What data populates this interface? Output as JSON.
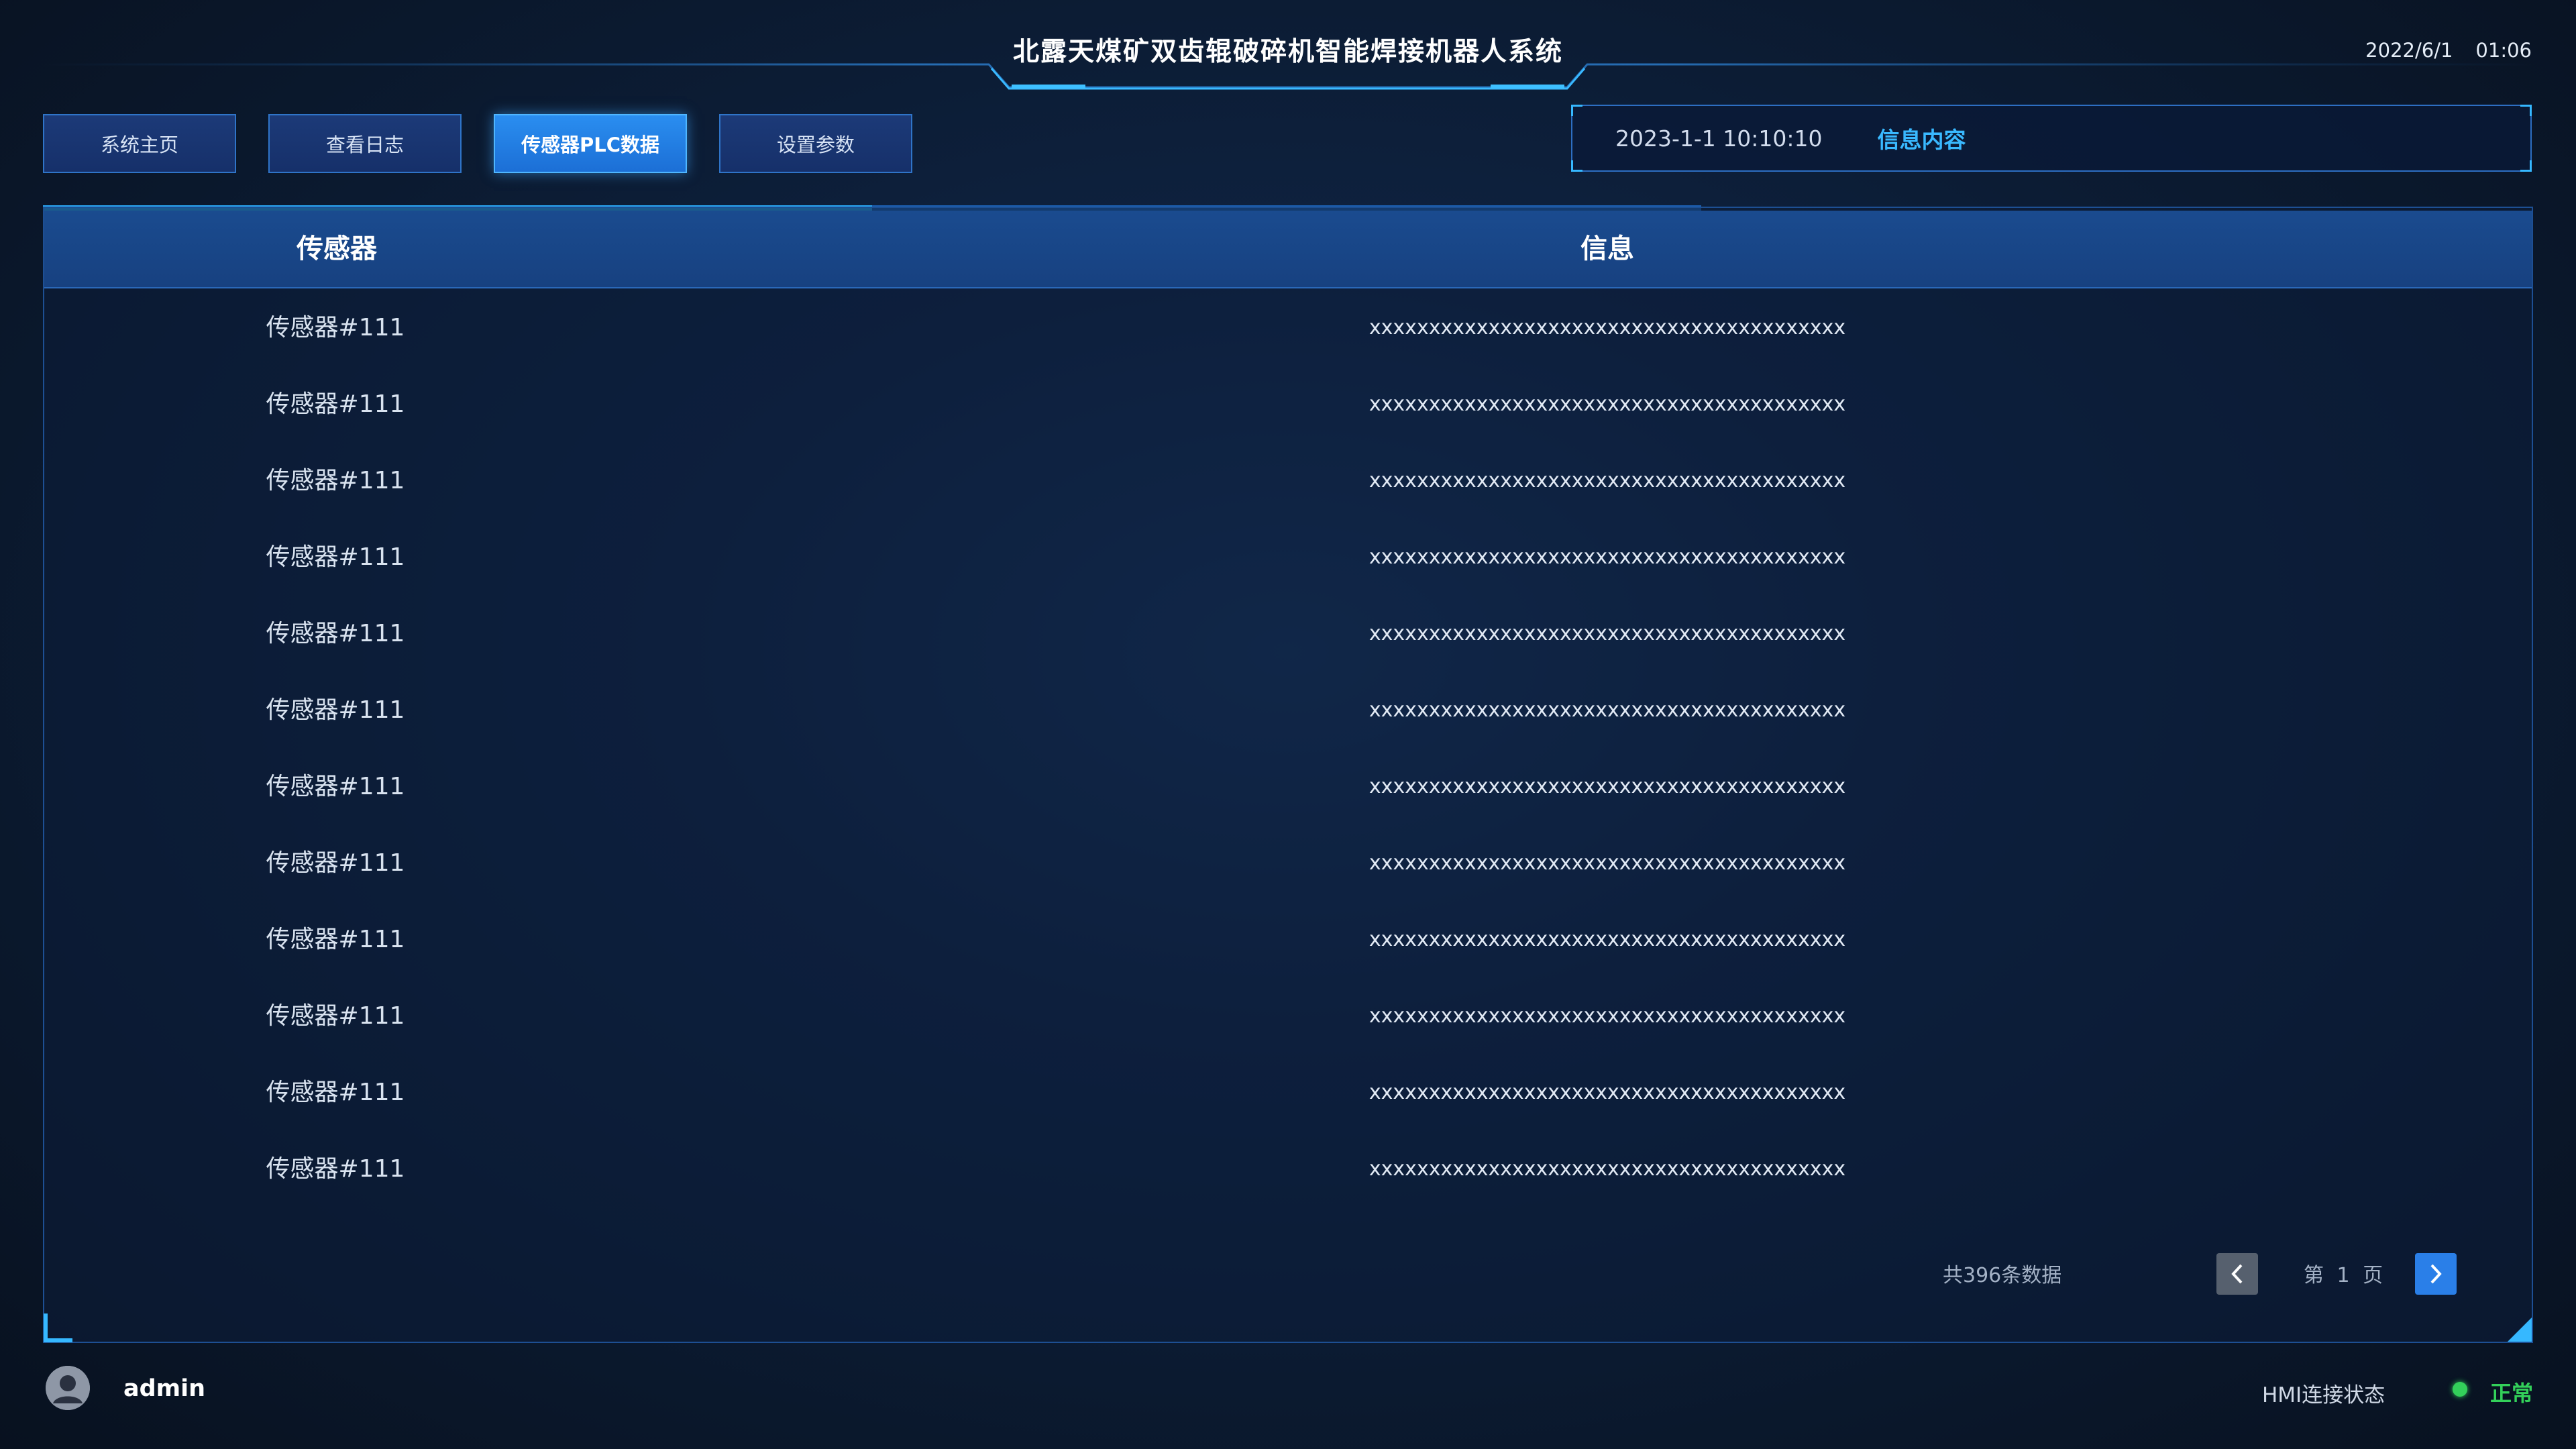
{
  "header": {
    "title": "北露天煤矿双齿辊破碎机智能焊接机器人系统",
    "date": "2022/6/1",
    "time": "01:06"
  },
  "nav": {
    "items": [
      {
        "label": "系统主页",
        "active": false
      },
      {
        "label": "查看日志",
        "active": false
      },
      {
        "label": "传感器PLC数据",
        "active": true
      },
      {
        "label": "设置参数",
        "active": false
      }
    ]
  },
  "info_box": {
    "time": "2023-1-1 10:10:10",
    "content": "信息内容"
  },
  "table": {
    "columns": [
      "传感器",
      "信息"
    ],
    "rows": [
      {
        "sensor": "传感器#111",
        "info": "xxxxxxxxxxxxxxxxxxxxxxxxxxxxxxxxxxxxxxxx"
      },
      {
        "sensor": "传感器#111",
        "info": "xxxxxxxxxxxxxxxxxxxxxxxxxxxxxxxxxxxxxxxx"
      },
      {
        "sensor": "传感器#111",
        "info": "xxxxxxxxxxxxxxxxxxxxxxxxxxxxxxxxxxxxxxxx"
      },
      {
        "sensor": "传感器#111",
        "info": "xxxxxxxxxxxxxxxxxxxxxxxxxxxxxxxxxxxxxxxx"
      },
      {
        "sensor": "传感器#111",
        "info": "xxxxxxxxxxxxxxxxxxxxxxxxxxxxxxxxxxxxxxxx"
      },
      {
        "sensor": "传感器#111",
        "info": "xxxxxxxxxxxxxxxxxxxxxxxxxxxxxxxxxxxxxxxx"
      },
      {
        "sensor": "传感器#111",
        "info": "xxxxxxxxxxxxxxxxxxxxxxxxxxxxxxxxxxxxxxxx"
      },
      {
        "sensor": "传感器#111",
        "info": "xxxxxxxxxxxxxxxxxxxxxxxxxxxxxxxxxxxxxxxx"
      },
      {
        "sensor": "传感器#111",
        "info": "xxxxxxxxxxxxxxxxxxxxxxxxxxxxxxxxxxxxxxxx"
      },
      {
        "sensor": "传感器#111",
        "info": "xxxxxxxxxxxxxxxxxxxxxxxxxxxxxxxxxxxxxxxx"
      },
      {
        "sensor": "传感器#111",
        "info": "xxxxxxxxxxxxxxxxxxxxxxxxxxxxxxxxxxxxxxxx"
      },
      {
        "sensor": "传感器#111",
        "info": "xxxxxxxxxxxxxxxxxxxxxxxxxxxxxxxxxxxxxxxx"
      }
    ]
  },
  "pagination": {
    "total_text": "共396条数据",
    "page_text": "第 1 页",
    "prev_icon": "chevron-left-icon",
    "next_icon": "chevron-right-icon"
  },
  "footer": {
    "username": "admin",
    "hmi_label": "HMI连接状态",
    "status": "正常",
    "status_color": "#33d05a"
  },
  "colors": {
    "accent": "#2a8ef0",
    "highlight": "#39b9ff",
    "background": "#0b1a30"
  }
}
